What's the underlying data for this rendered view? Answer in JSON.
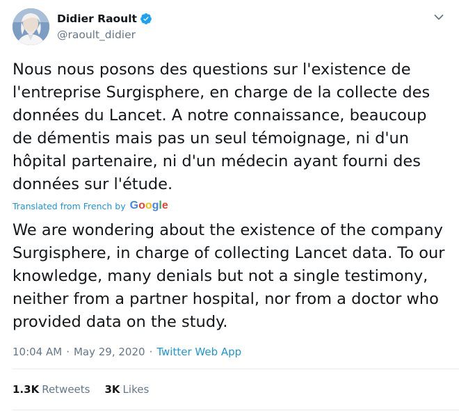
{
  "author": {
    "display_name": "Didier Raoult",
    "handle": "@raoult_didier",
    "verified": true
  },
  "tweet": {
    "original_text": "Nous nous posons des questions sur l'existence de l'entreprise Surgisphere, en charge de la collecte des données du Lancet. A notre connaissance, beaucoup de démentis mais pas un seul témoignage, ni d'un hôpital partenaire, ni d'un médecin ayant fourni des données sur l'étude.",
    "translation_label": "Translated from French",
    "translation_by": "by",
    "translation_provider": "Google",
    "translated_text": "We are wondering about the existence of the company Surgisphere, in charge of collecting Lancet data. To our knowledge, many denials but not a single testimony, neither from a partner hospital, nor from a doctor who provided data on the study."
  },
  "meta": {
    "time": "10:04 AM",
    "date": "May 29, 2020",
    "separator": "·",
    "source": "Twitter Web App"
  },
  "stats": {
    "retweets_count": "1.3K",
    "retweets_label": "Retweets",
    "likes_count": "3K",
    "likes_label": "Likes"
  },
  "icons": {
    "verified": "verified-badge-icon",
    "menu": "chevron-down-icon"
  },
  "colors": {
    "link_blue": "#1b95e0",
    "verified_blue": "#1da1f2",
    "secondary_text": "#657786",
    "primary_text": "#14171a",
    "divider": "#e6ecf0"
  }
}
